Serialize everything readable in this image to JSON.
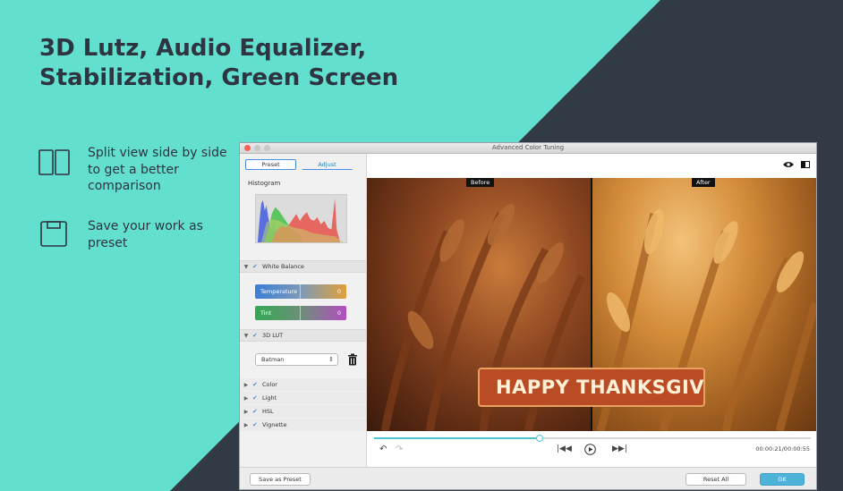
{
  "headline": "3D Lutz, Audio Equalizer, Stabilization, Green Screen",
  "features": [
    {
      "icon": "split-view-icon",
      "text": "Split view side by side to get a better comparison"
    },
    {
      "icon": "save-icon",
      "text": "Save your work as preset"
    }
  ],
  "window": {
    "title": "Advanced Color Tuning",
    "tabs": {
      "preset": "Preset",
      "adjust": "Adjust",
      "active": "Preset"
    },
    "histogram_label": "Histogram",
    "white_balance": {
      "label": "White Balance",
      "temperature_label": "Temperature",
      "temperature_value": "0",
      "tint_label": "Tint",
      "tint_value": "0"
    },
    "lut": {
      "label": "3D LUT",
      "selected": "Batman"
    },
    "sections": [
      "Color",
      "Light",
      "HSL",
      "Vignette"
    ],
    "preview": {
      "before_label": "Before",
      "after_label": "After",
      "banner_text": "HAPPY THANKSGIVI N"
    },
    "playback": {
      "timecode": "00:00:21/00:00:55",
      "progress": 0.38
    },
    "buttons": {
      "save_preset": "Save as Preset",
      "reset_all": "Reset All",
      "ok": "OK"
    }
  },
  "colors": {
    "accent": "#4fc3d6",
    "background_teal": "#63dfcf",
    "background_dark": "#323a46"
  }
}
